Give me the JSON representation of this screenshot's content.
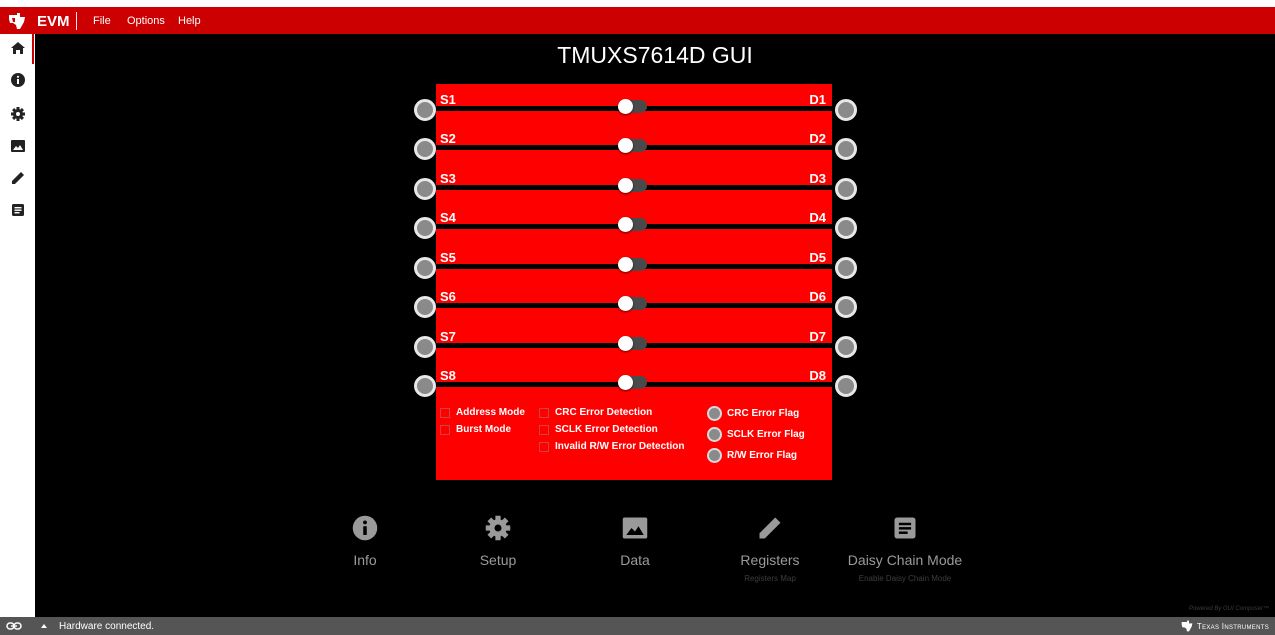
{
  "titlebar": {
    "app_name": "EVM",
    "menu": [
      "File",
      "Options",
      "Help"
    ]
  },
  "sidebar": {
    "items": [
      {
        "icon": "home-icon",
        "active": true
      },
      {
        "icon": "info-icon"
      },
      {
        "icon": "gear-icon"
      },
      {
        "icon": "image-icon"
      },
      {
        "icon": "pencil-icon"
      },
      {
        "icon": "document-icon"
      }
    ]
  },
  "main": {
    "title": "TMUXS7614D GUI",
    "channels": [
      {
        "source": "S1",
        "drain": "D1",
        "state": "off"
      },
      {
        "source": "S2",
        "drain": "D2",
        "state": "off"
      },
      {
        "source": "S3",
        "drain": "D3",
        "state": "off"
      },
      {
        "source": "S4",
        "drain": "D4",
        "state": "off"
      },
      {
        "source": "S5",
        "drain": "D5",
        "state": "off"
      },
      {
        "source": "S6",
        "drain": "D6",
        "state": "off"
      },
      {
        "source": "S7",
        "drain": "D7",
        "state": "off"
      },
      {
        "source": "S8",
        "drain": "D8",
        "state": "off"
      }
    ],
    "modes": [
      {
        "label": "Address Mode",
        "checked": false
      },
      {
        "label": "Burst Mode",
        "checked": false
      }
    ],
    "error_detection": [
      {
        "label": "CRC Error Detection",
        "checked": false
      },
      {
        "label": "SCLK Error Detection",
        "checked": false
      },
      {
        "label": "Invalid R/W Error Detection",
        "checked": false
      }
    ],
    "flags": [
      {
        "label": "CRC Error Flag"
      },
      {
        "label": "SCLK Error Flag"
      },
      {
        "label": "R/W Error Flag"
      }
    ]
  },
  "nav": {
    "info": {
      "label": "Info"
    },
    "setup": {
      "label": "Setup"
    },
    "data": {
      "label": "Data"
    },
    "registers": {
      "label": "Registers",
      "sub": "Registers Map"
    },
    "daisy": {
      "label": "Daisy Chain Mode",
      "sub": "Enable Daisy Chain Mode"
    }
  },
  "footer": {
    "powered_by": "Powered By GUI Composer™",
    "status": "Hardware connected.",
    "brand": "Texas Instruments"
  },
  "colors": {
    "accent": "#cc0000",
    "board": "#ff0000",
    "background": "#000000",
    "statusbar": "#555555"
  }
}
